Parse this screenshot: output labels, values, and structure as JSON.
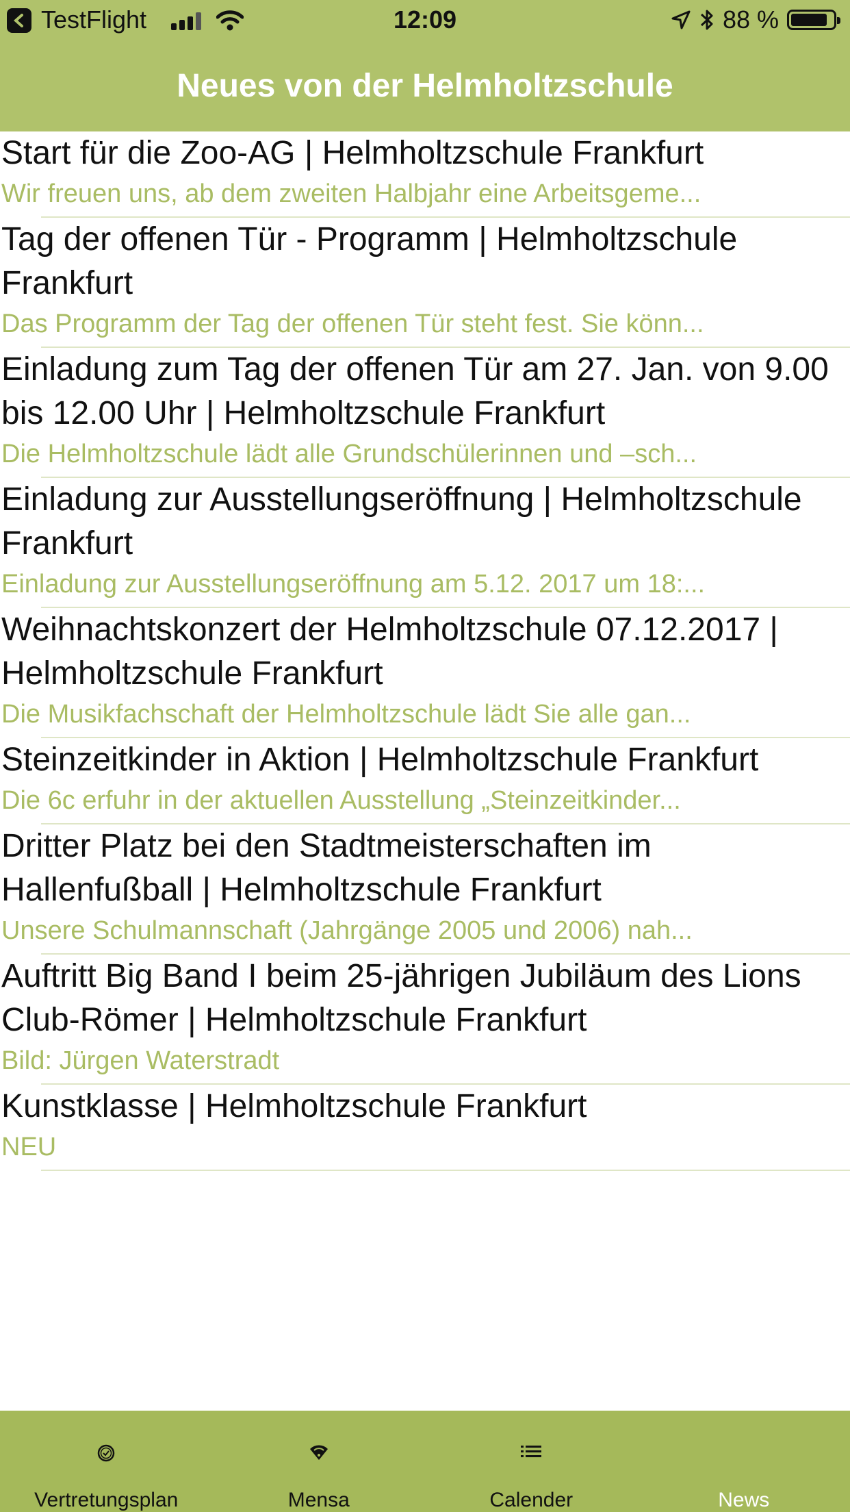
{
  "status_bar": {
    "back_app": "TestFlight",
    "time": "12:09",
    "battery": "88 %",
    "battery_level": 0.88
  },
  "nav": {
    "title": "Neues von der Helmholtzschule"
  },
  "colors": {
    "accent": "#b0c26b",
    "tab_bg": "#a5b95a",
    "subtitle": "#a9bc63"
  },
  "news": [
    {
      "title": "Start für die Zoo-AG | Helmholtzschule Frankfurt",
      "summary": "Wir freuen uns, ab dem zweiten Halbjahr eine Arbeitsgeme..."
    },
    {
      "title": "Tag der offenen Tür - Programm | Helmholtzschule Frankfurt",
      "summary": "Das Programm der Tag der offenen Tür steht fest. Sie könn..."
    },
    {
      "title": "Einladung zum Tag der offenen Tür am 27. Jan. von 9.00 bis 12.00 Uhr | Helmholtzschule Frankfurt",
      "summary": "Die Helmholtzschule lädt alle Grundschülerinnen und –sch..."
    },
    {
      "title": "Einladung zur Ausstellungseröffnung | Helmholtzschule Frankfurt",
      "summary": "Einladung zur Ausstellungseröffnung am 5.12. 2017 um 18:..."
    },
    {
      "title": "Weihnachtskonzert der Helmholtzschule 07.12.2017 | Helmholtzschule Frankfurt",
      "summary": "Die Musikfachschaft der Helmholtzschule lädt Sie alle gan..."
    },
    {
      "title": "Steinzeitkinder in Aktion | Helmholtzschule Frankfurt",
      "summary": "Die 6c erfuhr in der aktuellen Ausstellung „Steinzeitkinder..."
    },
    {
      "title": "Dritter Platz bei den Stadtmeisterschaften im Hallenfußball | Helmholtzschule Frankfurt",
      "summary": "Unsere Schulmannschaft (Jahrgänge 2005 und 2006) nah..."
    },
    {
      "title": "Auftritt Big Band I beim 25-jährigen Jubiläum des Lions Club-Römer | Helmholtzschule Frankfurt",
      "summary": "Bild: Jürgen Waterstradt"
    },
    {
      "title": "Kunstklasse | Helmholtzschule Frankfurt",
      "summary": "NEU"
    }
  ],
  "tabs": [
    {
      "label": "Vertretungsplan",
      "icon": "clock-icon"
    },
    {
      "label": "Mensa",
      "icon": "wifi-icon"
    },
    {
      "label": "Calender",
      "icon": "list-icon"
    },
    {
      "label": "News",
      "icon": "news-icon",
      "active": true
    }
  ]
}
